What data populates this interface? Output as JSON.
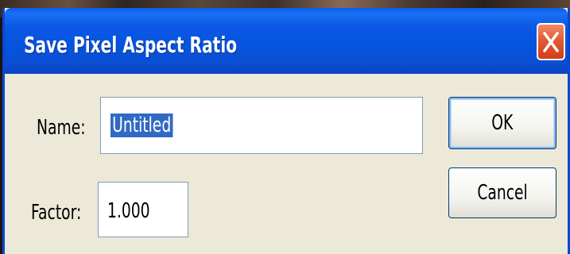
{
  "window": {
    "title": "Save Pixel Aspect Ratio",
    "close_icon": "close-icon",
    "accent_color": "#0a58e6",
    "close_color": "#e35a35"
  },
  "form": {
    "name_label": "Name:",
    "name_value": "Untitled",
    "factor_label": "Factor:",
    "factor_value": "1.000"
  },
  "buttons": {
    "ok_label": "OK",
    "cancel_label": "Cancel"
  }
}
